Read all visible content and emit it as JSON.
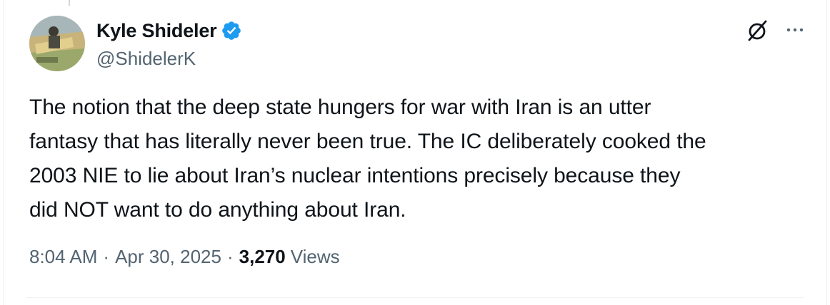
{
  "author": {
    "name": "Kyle Shideler",
    "handle": "@ShidelerK",
    "verified": true,
    "verified_color": "#1d9bf0"
  },
  "icons": {
    "avatar": "avatar-photo",
    "verified": "verified-badge-icon",
    "grok": "grok-icon",
    "more": "more-options-icon"
  },
  "tweet": {
    "text": "The notion that the deep state hungers for war with Iran is an utter\nfantasy that has literally never been true. The IC deliberately cooked the\n2003 NIE to lie about Iran’s nuclear intentions precisely because they\ndid NOT want to do anything about Iran."
  },
  "meta": {
    "time": "8:04 AM",
    "separator": "·",
    "date": "Apr 30, 2025",
    "views_count": "3,270",
    "views_label": "Views"
  },
  "colors": {
    "text_primary": "#0f1419",
    "text_secondary": "#536471",
    "border": "#eff3f4"
  }
}
